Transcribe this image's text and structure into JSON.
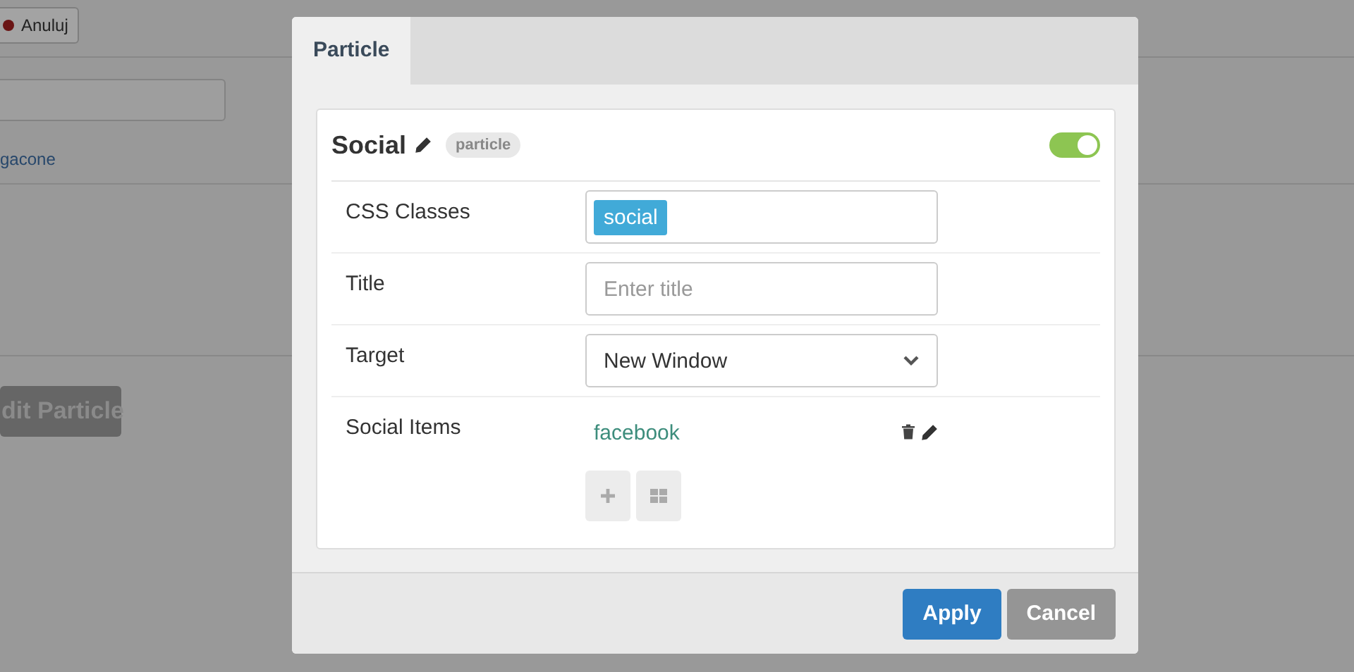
{
  "background": {
    "cancel_button": "Anuluj",
    "link": "gacone",
    "edit_button": "dit Particle"
  },
  "modal": {
    "tabs": [
      {
        "label": "Particle",
        "selected": true
      }
    ],
    "particle": {
      "title": "Social",
      "badge": "particle",
      "enabled": true
    },
    "fields": [
      {
        "kind": "tags",
        "label": "CSS Classes",
        "tags": [
          "social"
        ]
      },
      {
        "kind": "text",
        "label": "Title",
        "placeholder": "Enter title"
      },
      {
        "kind": "select",
        "label": "Target",
        "value": "New Window"
      },
      {
        "kind": "list",
        "label": "Social Items",
        "items": [
          "facebook"
        ]
      }
    ],
    "buttons": [
      {
        "label": "Apply",
        "kind": "primary"
      },
      {
        "label": "Cancel",
        "kind": "secondary"
      }
    ]
  }
}
